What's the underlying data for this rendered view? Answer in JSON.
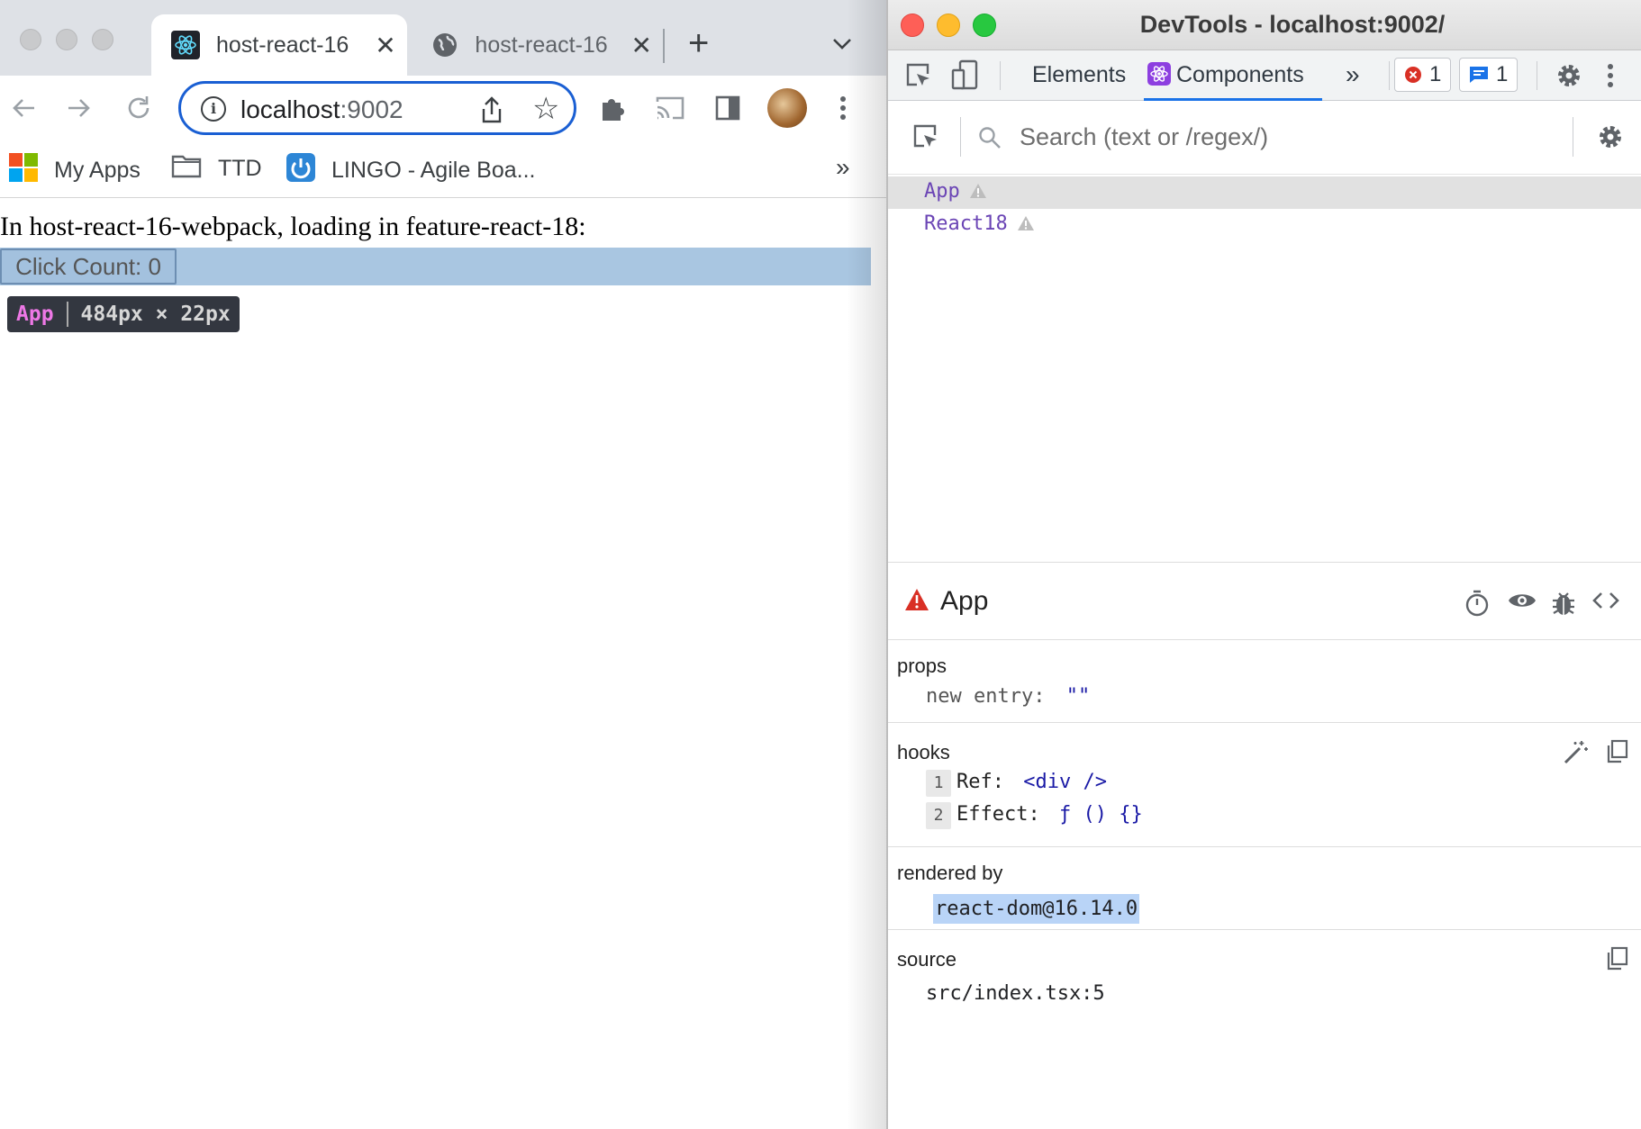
{
  "browser": {
    "tabs": [
      {
        "title": "host-react-16",
        "close": "✕",
        "favicon": "react-icon",
        "active": true
      },
      {
        "title": "host-react-16",
        "close": "✕",
        "favicon": "globe-icon",
        "active": false
      }
    ],
    "new_tab": "+",
    "url_host": "localhost",
    "url_port": ":9002",
    "bookmarks": [
      {
        "label": "My Apps",
        "icon": "microsoft-apps-icon"
      },
      {
        "label": "TTD",
        "icon": "folder-icon"
      },
      {
        "label": "LINGO - Agile Boa...",
        "icon": "lingo-power-icon"
      }
    ],
    "bookmarks_more": "»"
  },
  "page": {
    "text": "In host-react-16-webpack, loading in feature-react-18:",
    "button_label": "Click Count: 0",
    "overlay_name": "App",
    "overlay_dims": "484px × 22px"
  },
  "devtools": {
    "window_title": "DevTools - localhost:9002/",
    "tabs": {
      "elements": "Elements",
      "components": "Components",
      "more": "»"
    },
    "error_count": "1",
    "message_count": "1",
    "search_placeholder": "Search (text or /regex/)",
    "tree": [
      {
        "name": "App",
        "selected": true
      },
      {
        "name": "React18",
        "selected": false
      }
    ],
    "inspected": {
      "title": "App",
      "props_title": "props",
      "props": [
        {
          "key": "new entry",
          "value": "\"\""
        }
      ],
      "hooks_title": "hooks",
      "hooks": [
        {
          "num": "1",
          "key": "Ref",
          "value": "<div />"
        },
        {
          "num": "2",
          "key": "Effect",
          "value": "ƒ () {}"
        }
      ],
      "rendered_by_title": "rendered by",
      "rendered_by": "react-dom@16.14.0",
      "source_title": "source",
      "source": "src/index.tsx:5"
    }
  },
  "colors": {
    "accent_blue": "#1a73e8",
    "component_purple": "#6b45b5",
    "value_blue": "#1a1aa6",
    "warning_red": "#d93025",
    "overlay_name_pink": "#ee78e6"
  }
}
